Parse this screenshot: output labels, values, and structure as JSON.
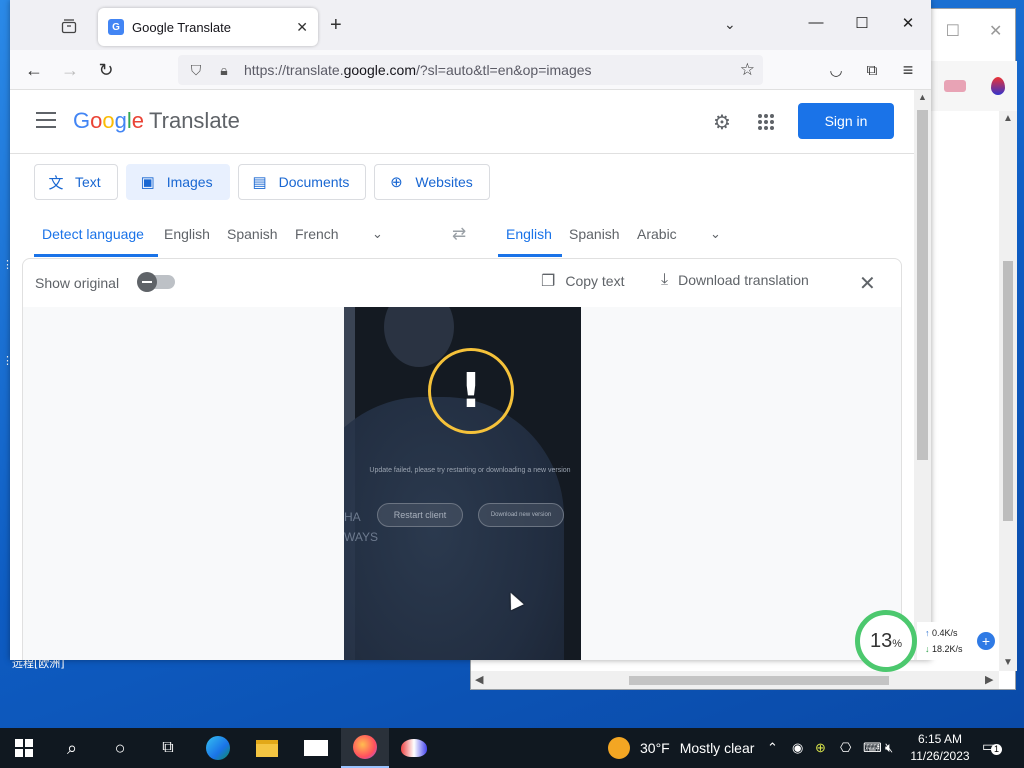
{
  "browser": {
    "tab_title": "Google Translate",
    "url_prefix": "https://translate.",
    "url_domain": "google.com",
    "url_suffix": "/?sl=auto&tl=en&op=images"
  },
  "header": {
    "logo_google": [
      "G",
      "o",
      "o",
      "g",
      "l",
      "e"
    ],
    "logo_product": "Translate",
    "signin_label": "Sign in"
  },
  "modes": [
    {
      "label": "Text",
      "icon": "translate-icon"
    },
    {
      "label": "Images",
      "icon": "image-icon",
      "active": true
    },
    {
      "label": "Documents",
      "icon": "document-icon"
    },
    {
      "label": "Websites",
      "icon": "globe-icon"
    }
  ],
  "source_langs": [
    "Detect language",
    "English",
    "Spanish",
    "French"
  ],
  "target_langs": [
    "English",
    "Spanish",
    "Arabic"
  ],
  "card": {
    "show_original": "Show original",
    "show_original_on": false,
    "copy_text": "Copy text",
    "download": "Download translation"
  },
  "image": {
    "message": "Update failed, please try restarting or downloading a new version",
    "button_restart": "Restart client",
    "button_download": "Download new version",
    "side_letters": "HA\nWAYS"
  },
  "net_widget": {
    "percent": "13",
    "percent_unit": "%",
    "upload": "0.4K/s",
    "download": "18.2K/s"
  },
  "taskbar": {
    "weather_temp": "30°F",
    "weather_desc": "Mostly clear",
    "time": "6:15 AM",
    "date": "11/26/2023",
    "notification_count": "1"
  },
  "desktop": {
    "glyph_text": "远程[欧洲]"
  }
}
